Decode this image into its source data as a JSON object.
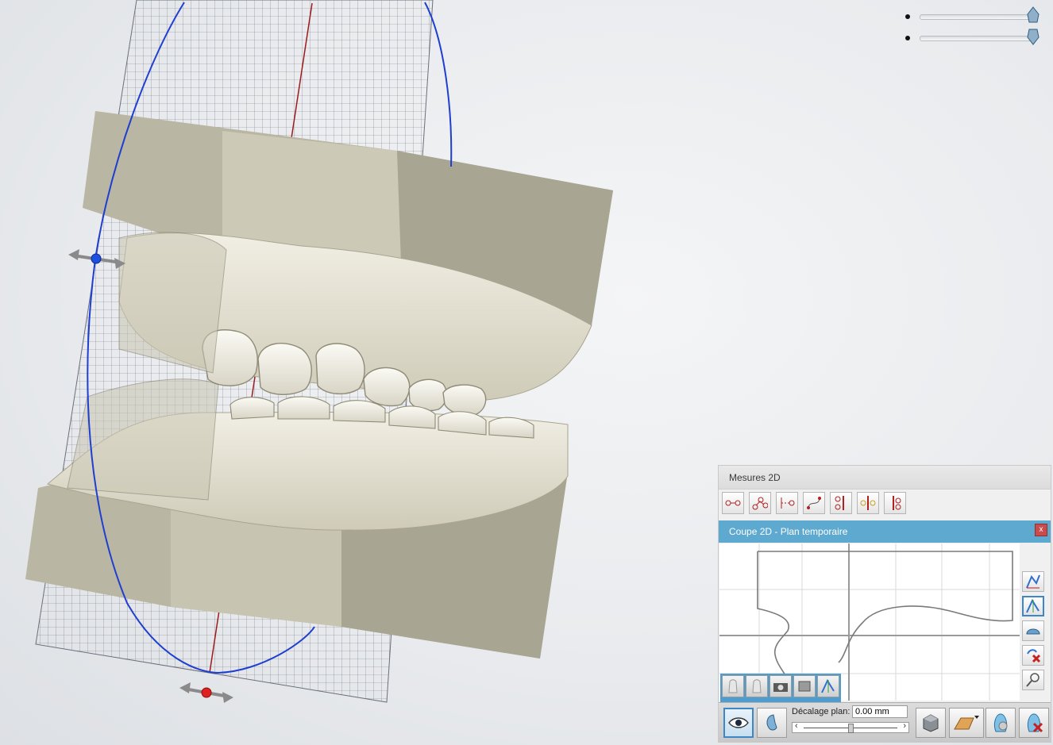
{
  "viewport": {
    "label": "3D view",
    "sliders": [
      {
        "name": "opacity-upper",
        "value": 0.97
      },
      {
        "name": "opacity-lower",
        "value": 0.97
      }
    ],
    "colors": {
      "plane_curve": "#1f3fd0",
      "axis_line": "#9b1c1c",
      "model": "#e3e1d2",
      "base": "#b9b6a3"
    }
  },
  "panel": {
    "mesures_title": "Mesures 2D",
    "tools": [
      {
        "icon": "point-distance-icon"
      },
      {
        "icon": "angle-icon"
      },
      {
        "icon": "line-distance-icon"
      },
      {
        "icon": "curve-distance-icon"
      },
      {
        "icon": "vertical-distance-icon"
      },
      {
        "icon": "plane-distance-icon"
      },
      {
        "icon": "point-to-point-icon"
      }
    ],
    "coupe_title": "Coupe 2D - Plan temporaire",
    "close_label": "x",
    "offset_label": "Décalage plan:",
    "offset_value": "0.00 mm",
    "colors": {
      "title_bar": "#5ea9cf",
      "active_border": "#3f86c6"
    }
  }
}
